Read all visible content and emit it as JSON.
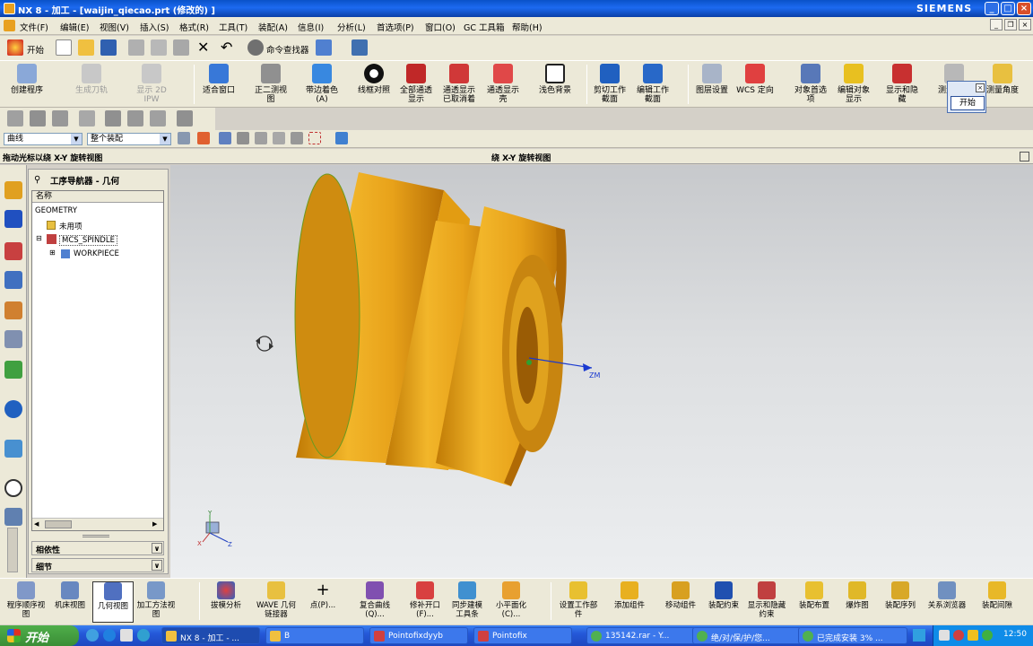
{
  "window": {
    "title": "NX 8 - 加工 - [waijin_qiecao.prt (修改的) ]",
    "brand": "SIEMENS"
  },
  "menu": [
    "文件(F)",
    "编辑(E)",
    "视图(V)",
    "插入(S)",
    "格式(R)",
    "工具(T)",
    "装配(A)",
    "信息(I)",
    "分析(L)",
    "首选项(P)",
    "窗口(O)",
    "GC 工具箱",
    "帮助(H)"
  ],
  "std_toolbar": {
    "start": "开始",
    "finder": "命令查找器"
  },
  "ribbon": [
    "创建程序",
    "生成刀轨",
    "显示 2D IPW",
    "适合窗口",
    "正二测视图",
    "带边着色(A)",
    "线框对照",
    "全部通透显示",
    "通透显示已取消着",
    "通透显示壳",
    "浅色背景",
    "剪切工作截面",
    "编辑工作截面",
    "图层设置",
    "WCS 定向",
    "对象首选项",
    "编辑对象显示",
    "显示和隐藏",
    "测量距离",
    "测量角度"
  ],
  "popup": {
    "label": "开始"
  },
  "selection": {
    "filter": "曲线",
    "scope": "整个装配"
  },
  "cue": {
    "left": "拖动光标以绕 X-Y 旋转视图",
    "right": "绕 X-Y 旋转视图"
  },
  "navigator": {
    "title": "工序导航器 - 几何",
    "column": "名称",
    "items": [
      "GEOMETRY",
      "未用项",
      "MCS_SPINDLE",
      "WORKPIECE"
    ],
    "sections": [
      "相依性",
      "细节"
    ]
  },
  "viewport": {
    "axis_zm": "ZM",
    "triad_x": "X",
    "triad_y": "Y",
    "triad_z": "Z"
  },
  "bottom_toolbar": [
    "程序顺序视图",
    "机床视图",
    "几何视图",
    "加工方法视图",
    "拔模分析",
    "WAVE 几何链接器",
    "点(P)...",
    "复合曲线(Q)...",
    "修补开口(F)...",
    "同步建模工具条",
    "小平面化(C)...",
    "设置工作部件",
    "添加组件",
    "移动组件",
    "装配约束",
    "显示和隐藏约束",
    "装配布置",
    "爆炸图",
    "装配序列",
    "关系浏览器",
    "装配间隙"
  ],
  "taskbar": {
    "start": "开始",
    "tasks": [
      "NX 8 - 加工 - ...",
      "B",
      "Pointofixdyyb",
      "Pointofix",
      "135142.rar - Y...",
      "绝/对/保/护/您...",
      "已完成安装 3% ..."
    ],
    "clock": "12:50"
  }
}
